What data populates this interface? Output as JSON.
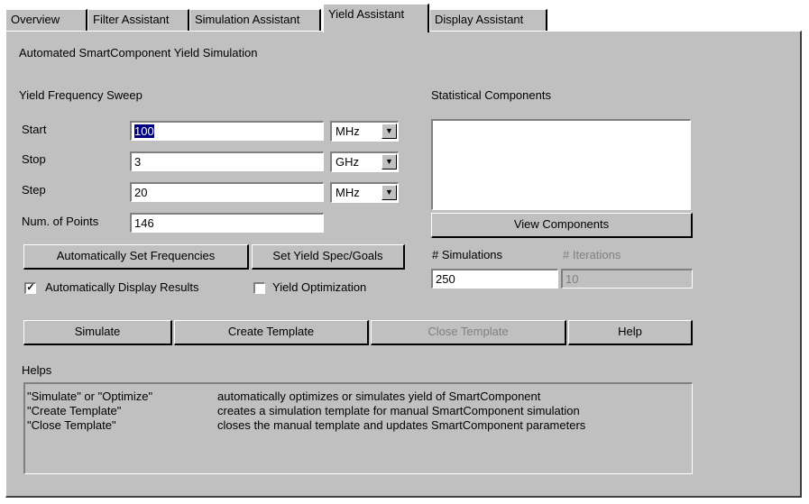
{
  "tabs": [
    "Overview",
    "Filter Assistant",
    "Simulation Assistant",
    "Yield Assistant",
    "Display Assistant"
  ],
  "active_tab": "Yield Assistant",
  "page_title": "Automated SmartComponent Yield Simulation",
  "sweep": {
    "heading": "Yield Frequency Sweep",
    "start_label": "Start",
    "start_value": "100",
    "start_unit": "MHz",
    "stop_label": "Stop",
    "stop_value": "3",
    "stop_unit": "GHz",
    "step_label": "Step",
    "step_value": "20",
    "step_unit": "MHz",
    "points_label": "Num. of Points",
    "points_value": "146"
  },
  "buttons": {
    "auto_freq": "Automatically Set Frequencies",
    "yield_spec": "Set Yield Spec/Goals",
    "view_components": "View Components",
    "simulate": "Simulate",
    "create_template": "Create Template",
    "close_template": "Close Template",
    "help": "Help"
  },
  "checkboxes": {
    "auto_display": "Automatically Display Results",
    "auto_display_checked": true,
    "yield_opt": "Yield Optimization",
    "yield_opt_checked": false
  },
  "statistical": {
    "heading": "Statistical Components",
    "simulations_label": "# Simulations",
    "simulations_value": "250",
    "iterations_label": "# Iterations",
    "iterations_value": "10"
  },
  "helps": {
    "heading": "Helps",
    "rows": [
      {
        "key": "\"Simulate\" or \"Optimize\"",
        "desc": "automatically optimizes or simulates yield of SmartComponent"
      },
      {
        "key": "\"Create Template\"",
        "desc": "creates a simulation template for manual SmartComponent simulation"
      },
      {
        "key": "\"Close Template\"",
        "desc": "closes the manual template and updates SmartComponent parameters"
      }
    ]
  },
  "icons": {
    "dropdown": "chevron-down-icon",
    "check": "checkmark-icon"
  }
}
